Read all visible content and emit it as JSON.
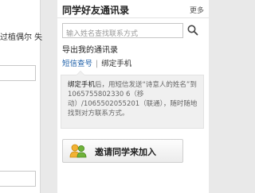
{
  "left": {
    "text_fragment": "过植偶尔 失"
  },
  "panel": {
    "title": "同学好友通讯录",
    "more_label": "更多",
    "search": {
      "placeholder": "输入姓名查找联系方式",
      "icon": "search-icon"
    },
    "export_label": "导出我的通讯录",
    "tabs": [
      {
        "label": "短信查号",
        "active": true
      },
      {
        "label": "绑定手机",
        "active": false
      }
    ],
    "info": {
      "bold_lead": "绑定手机",
      "text_rest": "后，用短信发送“诗意人的姓名”到1065755802330 6（移动）/1065502055201（联通），随时随地找到对方联系方式。"
    },
    "invite_button": {
      "label": "邀请同学来加入",
      "icon": "people-icon"
    }
  },
  "colors": {
    "background": "#e9e9e9",
    "tab_active": "#1d5fa8",
    "info_box": "#f0f0f0"
  }
}
